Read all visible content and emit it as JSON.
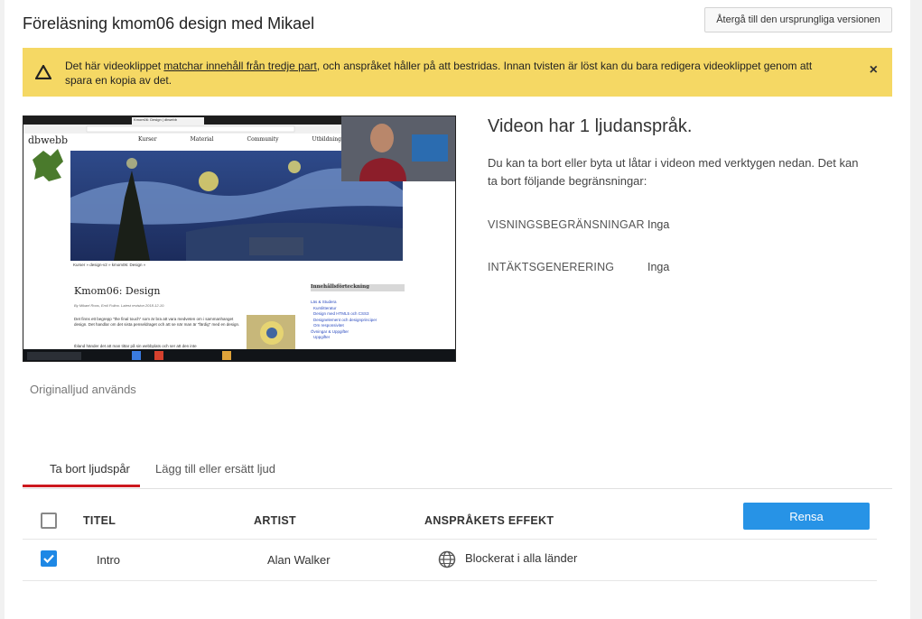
{
  "page": {
    "title": "Föreläsning kmom06 design med Mikael",
    "revert_button": "Återgå till den ursprungliga versionen"
  },
  "banner": {
    "text_before": "Det här videoklippet ",
    "link": "matchar innehåll från tredje part",
    "text_after": ", och anspråket håller på att bestridas. Innan tvisten är löst kan du bara redigera videoklippet genom att spara en kopia av det.",
    "close": "×",
    "color": "#f5d864"
  },
  "video": {
    "browser_tab": "Kmom06: Design | dbwebb",
    "logo": "dbwebb",
    "nav": [
      "Kurser",
      "Material",
      "Community",
      "Utbildning"
    ],
    "breadcrumb": "Kurser » design-v2 » kmom06: Design »",
    "heading": "Kmom06: Design",
    "byline": "By Mikael Roos, Emil Folino. Latest revision 2018-12-10.",
    "body1": "Det finns ett begrepp \"the final touch\" som är bra att vara medveten om i sammanhanget design. Det handlar om det sista penseldraget och att se när man är \"färdig\" med en design.",
    "body2": "Ibland händer det att man tittar på sin webbplats och ser att den inte",
    "toc_title": "Innehållsförteckning",
    "toc": [
      "Läs & Studera",
      "Kurslitteratur",
      "Design med HTML5 och CSS3",
      "Designelement och designprinciper",
      "Om responsivitet",
      "Övningar & Uppgifter",
      "Uppgifter"
    ]
  },
  "original_audio": "Originalljud används",
  "info": {
    "title": "Videon har 1 ljudanspråk.",
    "description": "Du kan ta bort eller byta ut låtar i videon med verktygen nedan. Det kan ta bort följande begränsningar:",
    "restrictions_label": "VISNINGSBEGRÄNSNINGAR",
    "restrictions_value": "Inga",
    "monetization_label": "INTÄKTSGENERERING",
    "monetization_value": "Inga"
  },
  "tabs": [
    {
      "label": "Ta bort ljudspår",
      "active": true
    },
    {
      "label": "Lägg till eller ersätt ljud",
      "active": false
    }
  ],
  "table": {
    "headers": [
      "TITEL",
      "ARTIST",
      "ANSPRÅKETS EFFEKT"
    ],
    "clear_button": "Rensa",
    "rows": [
      {
        "checked": true,
        "title": "Intro",
        "artist": "Alan Walker",
        "effect_icon": "globe-icon",
        "effect": "Blockerat i alla länder"
      }
    ]
  },
  "colors": {
    "accent": "#2793e6",
    "tab_underline": "#cc181e",
    "checkbox": "#1e88e5"
  }
}
